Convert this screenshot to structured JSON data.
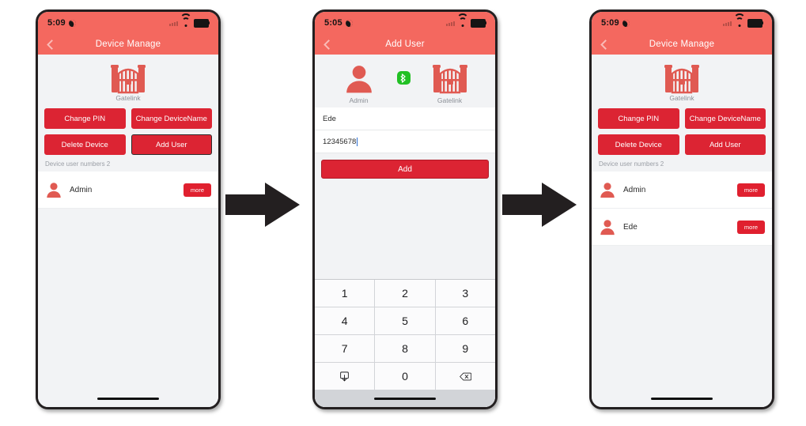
{
  "page": {
    "title": "Gatelink app — add user flow",
    "background": "#ffffff",
    "accent_red": "#dc2433",
    "header_red": "#f4685f",
    "bluetooth_green": "#22c024"
  },
  "arrows": [
    {
      "name": "flow-arrow-1",
      "direction": "right"
    },
    {
      "name": "flow-arrow-2",
      "direction": "right"
    }
  ],
  "phones": [
    {
      "id": "device-manage-before",
      "status_bar": {
        "time": "5:09",
        "dnd_icon": "crescent-moon-icon",
        "signal_icon": "signal-bars-icon",
        "wifi_icon": "wifi-icon",
        "battery_icon": "battery-full-icon"
      },
      "nav": {
        "back_icon": "chevron-left-icon",
        "title": "Device Manage"
      },
      "hero": {
        "device_icon": "gate-icon",
        "device_label": "Gatelink"
      },
      "buttons": [
        {
          "label": "Change PIN",
          "focused": false
        },
        {
          "label": "Change DeviceName",
          "focused": false
        },
        {
          "label": "Delete Device",
          "focused": false
        },
        {
          "label": "Add User",
          "focused": true
        }
      ],
      "list_header": "Device user numbers 2",
      "users": [
        {
          "name": "Admin",
          "avatar_icon": "person-icon",
          "more_label": "more"
        }
      ]
    },
    {
      "id": "add-user-form",
      "status_bar": {
        "time": "5:05",
        "dnd_icon": "crescent-moon-icon",
        "signal_icon": "signal-bars-icon",
        "wifi_icon": "wifi-icon",
        "battery_icon": "battery-full-icon"
      },
      "nav": {
        "back_icon": "chevron-left-icon",
        "title": "Add User"
      },
      "hero_pair": {
        "admin_label": "Admin",
        "admin_icon": "person-icon",
        "link_icon": "bluetooth-icon",
        "device_label": "Gatelink",
        "device_icon": "gate-icon"
      },
      "form": {
        "name_value": "Ede",
        "name_placeholder": "Ede",
        "pin_value": "12345678",
        "pin_placeholder": "12345678",
        "submit_label": "Add"
      },
      "keypad": {
        "keys": [
          "1",
          "2",
          "3",
          "4",
          "5",
          "6",
          "7",
          "8",
          "9"
        ],
        "zero": "0",
        "dismiss_icon": "keyboard-dismiss-icon",
        "backspace_icon": "backspace-icon"
      }
    },
    {
      "id": "device-manage-after",
      "status_bar": {
        "time": "5:09",
        "dnd_icon": "crescent-moon-icon",
        "signal_icon": "signal-bars-icon",
        "wifi_icon": "wifi-icon",
        "battery_icon": "battery-full-icon"
      },
      "nav": {
        "back_icon": "chevron-left-icon",
        "title": "Device Manage"
      },
      "hero": {
        "device_icon": "gate-icon",
        "device_label": "Gatelink"
      },
      "buttons": [
        {
          "label": "Change PIN",
          "focused": false
        },
        {
          "label": "Change DeviceName",
          "focused": false
        },
        {
          "label": "Delete Device",
          "focused": false
        },
        {
          "label": "Add User",
          "focused": false
        }
      ],
      "list_header": "Device user numbers 2",
      "users": [
        {
          "name": "Admin",
          "avatar_icon": "person-icon",
          "more_label": "more"
        },
        {
          "name": "Ede",
          "avatar_icon": "person-icon",
          "more_label": "more"
        }
      ]
    }
  ]
}
